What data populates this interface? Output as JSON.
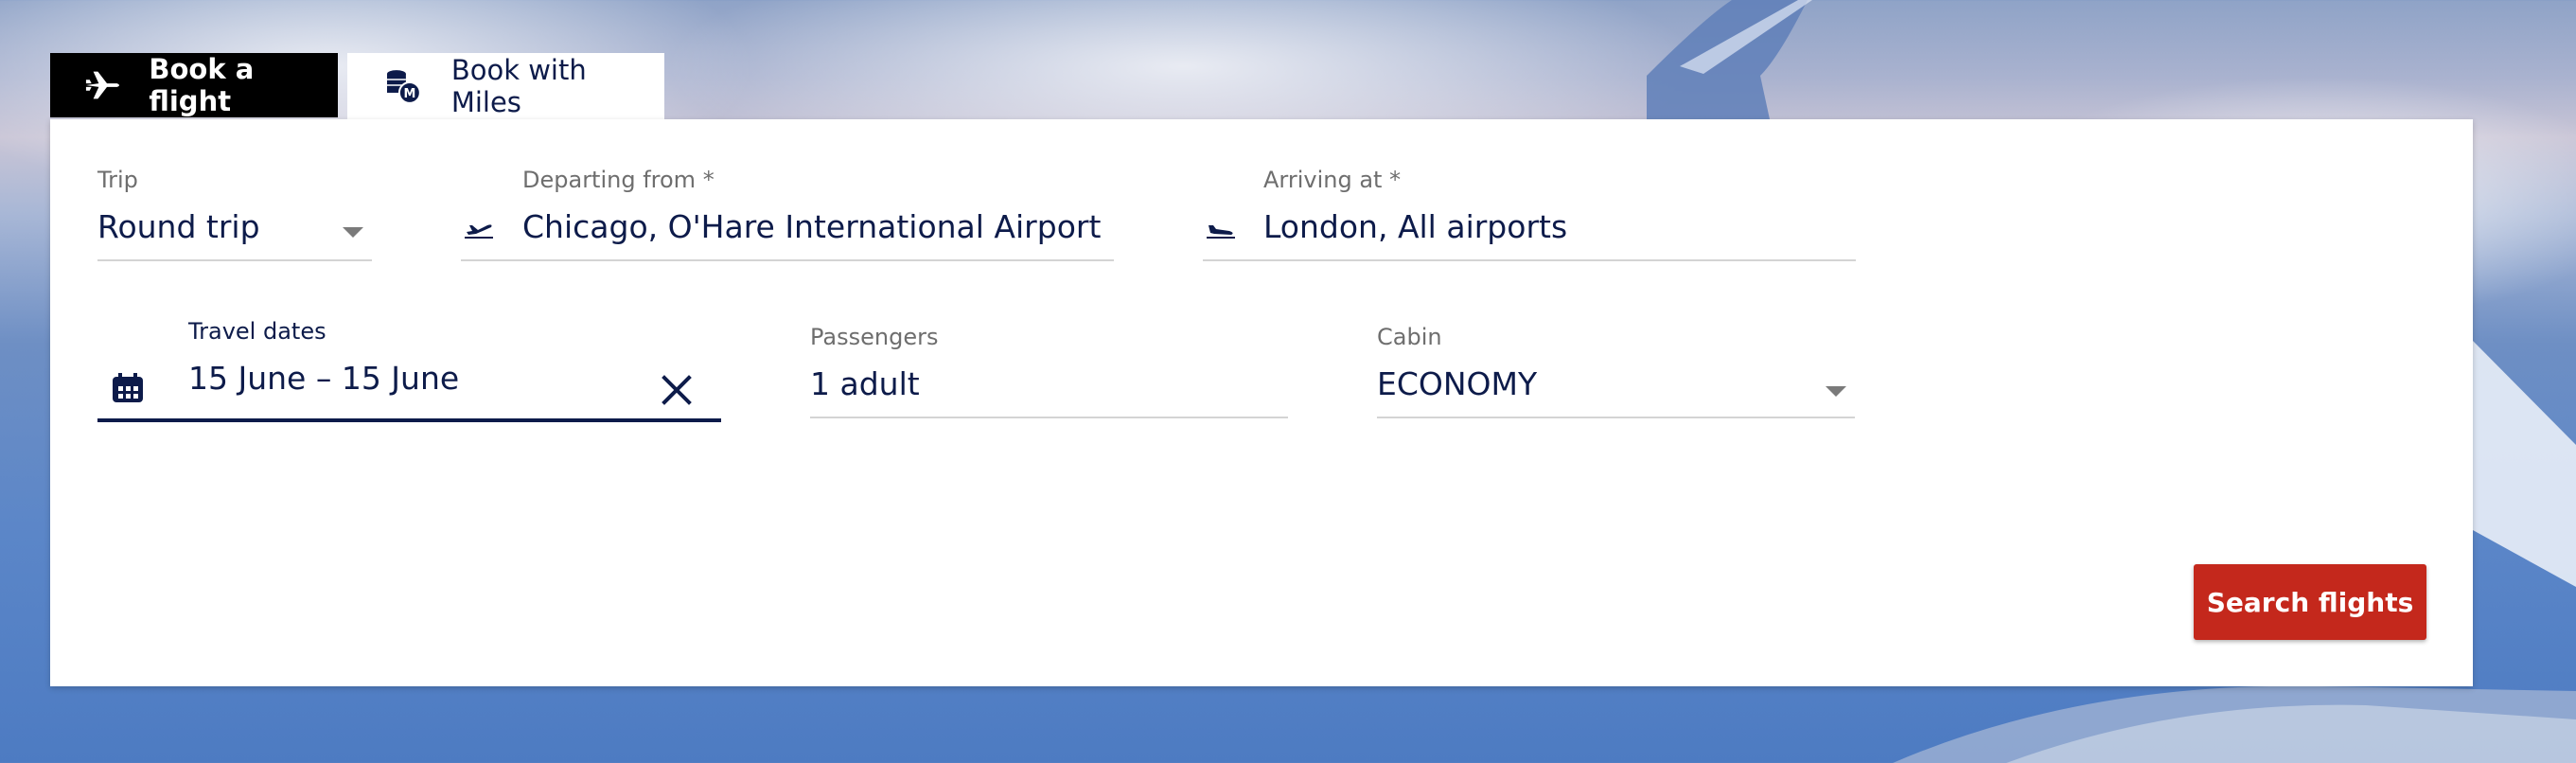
{
  "tabs": {
    "book_flight": "Book a flight",
    "book_miles": "Book with Miles"
  },
  "form": {
    "trip": {
      "label": "Trip",
      "value": "Round trip"
    },
    "departing": {
      "label": "Departing from *",
      "value": "Chicago, O'Hare International Airport"
    },
    "arriving": {
      "label": "Arriving at *",
      "value": "London, All airports"
    },
    "dates": {
      "label": "Travel dates",
      "value": "15 June – 15 June"
    },
    "passengers": {
      "label": "Passengers",
      "value": "1 adult"
    },
    "cabin": {
      "label": "Cabin",
      "value": "ECONOMY"
    }
  },
  "search_button": "Search flights",
  "colors": {
    "navy": "#0d1b4a",
    "accent_red": "#c4281c",
    "tab_active_bg": "#000000"
  },
  "icons": [
    "plane-icon",
    "miles-coins-icon",
    "takeoff-icon",
    "landing-icon",
    "calendar-icon",
    "clear-icon",
    "dropdown-caret-icon"
  ]
}
